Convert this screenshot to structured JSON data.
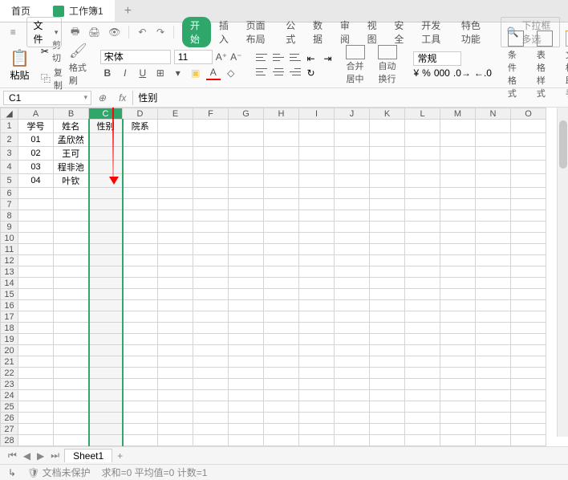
{
  "tabs": {
    "home": "首页",
    "workbook": "工作簿1"
  },
  "file_menu": "文件",
  "ribbon": {
    "start": "开始",
    "insert": "插入",
    "layout": "页面布局",
    "formula": "公式",
    "data": "数据",
    "review": "审阅",
    "view": "视图",
    "security": "安全",
    "developer": "开发工具",
    "special": "特色功能"
  },
  "search_placeholder": "下拉框多选",
  "toolbar": {
    "paste": "粘贴",
    "cut": "剪切",
    "copy": "复制",
    "format_painter": "格式刷",
    "font_name": "宋体",
    "font_size": "11",
    "merge_center": "合并居中",
    "auto_wrap": "自动换行",
    "number_format": "常规",
    "cond_format": "条件格式",
    "cell_style": "表格样式",
    "doc_assist": "文档助手"
  },
  "namebox": "C1",
  "formula": "性别",
  "columns": [
    "A",
    "B",
    "C",
    "D",
    "E",
    "F",
    "G",
    "H",
    "I",
    "J",
    "K",
    "L",
    "M",
    "N",
    "O"
  ],
  "row_count": 30,
  "cells": {
    "A1": "学号",
    "B1": "姓名",
    "C1": "性别",
    "D1": "院系",
    "A2": "01",
    "B2": "孟欣然",
    "A3": "02",
    "B3": "王可",
    "A4": "03",
    "B4": "程非池",
    "A5": "04",
    "B5": "叶钦"
  },
  "sheet_tab": "Sheet1",
  "status": {
    "protect": "文档未保护",
    "sum": "求和=0 平均值=0 计数=1"
  },
  "selected_column": "C",
  "col_widths": {
    "default": 44,
    "A": 44,
    "B": 44,
    "C": 42,
    "D": 44
  }
}
